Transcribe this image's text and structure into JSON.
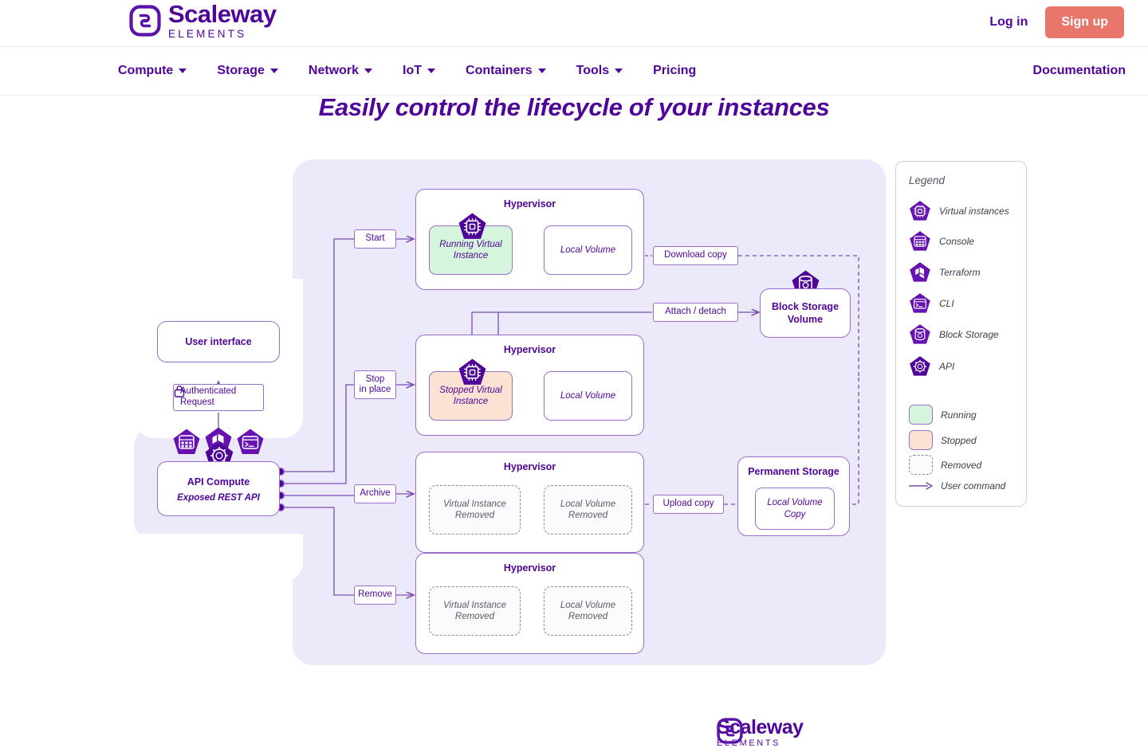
{
  "header": {
    "logo_word": "Scaleway",
    "logo_sub": "ELEMENTS",
    "login_label": "Log in",
    "signup_label": "Sign up"
  },
  "nav": {
    "items": [
      {
        "label": "Compute",
        "has_caret": true
      },
      {
        "label": "Storage",
        "has_caret": true
      },
      {
        "label": "Network",
        "has_caret": true
      },
      {
        "label": "IoT",
        "has_caret": true
      },
      {
        "label": "Containers",
        "has_caret": true
      },
      {
        "label": "Tools",
        "has_caret": true
      },
      {
        "label": "Pricing",
        "has_caret": false
      }
    ],
    "documentation": "Documentation"
  },
  "page_title": "Easily control the lifecycle of your instances",
  "diagram": {
    "user_interface": {
      "title": "User interface",
      "icons": [
        "console-icon",
        "terraform-icon",
        "cli-icon"
      ]
    },
    "auth_request": "Authenticated\nRequest",
    "auth_request_line1": "Authenticated",
    "auth_request_line2": "Request",
    "api_compute": {
      "title": "API Compute",
      "subtitle": "Exposed REST API",
      "icon": "api-icon"
    },
    "commands": [
      {
        "label": "Start"
      },
      {
        "label_line1": "Stop",
        "label_line2": "in place"
      },
      {
        "label": "Archive"
      },
      {
        "label": "Remove"
      }
    ],
    "hypervisors": [
      {
        "title": "Hypervisor",
        "left_box": "Running Virtual Instance",
        "left_box_line1": "Running Virtual",
        "left_box_line2": "Instance",
        "left_state": "running",
        "right_box": "Local Volume",
        "right_state": "normal"
      },
      {
        "title": "Hypervisor",
        "left_box": "Stopped Virtual Instance",
        "left_box_line1": "Stopped Virtual",
        "left_box_line2": "Instance",
        "left_state": "stopped",
        "right_box": "Local Volume",
        "right_state": "normal"
      },
      {
        "title": "Hypervisor",
        "left_box_line1": "Virtual Instance",
        "left_box_line2": "Removed",
        "left_state": "removed",
        "right_box_line1": "Local Volume",
        "right_box_line2": "Removed",
        "right_state": "removed"
      },
      {
        "title": "Hypervisor",
        "left_box_line1": "Virtual Instance",
        "left_box_line2": "Removed",
        "left_state": "removed",
        "right_box_line1": "Local Volume",
        "right_box_line2": "Removed",
        "right_state": "removed"
      }
    ],
    "edge_labels": {
      "download_copy": "Download copy",
      "attach_detach": "Attach / detach",
      "upload_copy": "Upload copy"
    },
    "block_storage": {
      "title_line1": "Block Storage",
      "title_line2": "Volume",
      "icon": "block-storage-icon"
    },
    "permanent_storage": {
      "title": "Permanent Storage",
      "inner_line1": "Local Volume",
      "inner_line2": "Copy"
    },
    "logo_word": "Scaleway",
    "logo_sub": "ELEMENTS"
  },
  "legend": {
    "title": "Legend",
    "icon_items": [
      {
        "label": "Virtual instances",
        "icon": "virtual-instance-icon"
      },
      {
        "label": "Console",
        "icon": "console-icon"
      },
      {
        "label": "Terraform",
        "icon": "terraform-icon"
      },
      {
        "label": "CLI",
        "icon": "cli-icon"
      },
      {
        "label": "Block Storage",
        "icon": "block-storage-icon"
      },
      {
        "label": "API",
        "icon": "api-icon"
      }
    ],
    "state_items": [
      {
        "label": "Running",
        "state": "running"
      },
      {
        "label": "Stopped",
        "state": "stopped"
      },
      {
        "label": "Removed",
        "state": "removed"
      }
    ],
    "arrow_item": {
      "label": "User command",
      "icon": "arrow-right-icon"
    }
  },
  "colors": {
    "brand_purple": "#4f0599",
    "accent_coral": "#e8766a",
    "panel_lilac": "#ece9fa",
    "stroke_purple": "#9a6fc9",
    "running_green": "#d6f5dd",
    "stopped_peach": "#fbe2d2"
  }
}
